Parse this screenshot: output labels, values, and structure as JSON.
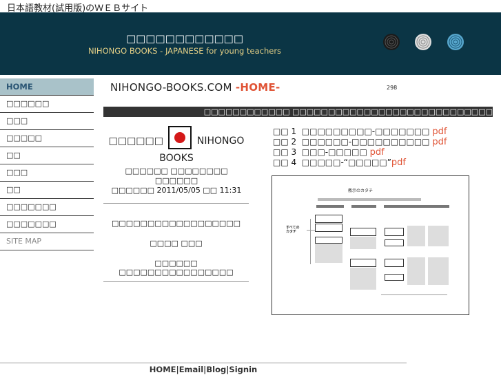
{
  "top_bar": {
    "text": "日本語教材(試用版)のＷＥＢサイト"
  },
  "banner": {
    "title": "□□□□□□□□□□□□",
    "subtitle": "NIHONGO BOOKS - JAPANESE for young teachers",
    "ring_color_dark": "#1b1b1b",
    "ring_color_light": "#cfcfcf",
    "ring_color_blue": "#57a6cc"
  },
  "sidebar": {
    "items": [
      {
        "label": "HOME"
      },
      {
        "label": "□□□□□□"
      },
      {
        "label": "□□□"
      },
      {
        "label": "□□□□□"
      },
      {
        "label": "□□"
      },
      {
        "label": "□□□"
      },
      {
        "label": "□□"
      },
      {
        "label": "□□□□□□□"
      },
      {
        "label": "□□□□□□□"
      },
      {
        "label": "SITE MAP"
      }
    ]
  },
  "main": {
    "heading_site": "NIHONGO-BOOKS.COM ",
    "heading_page": "-HOME-",
    "counter": "298",
    "dark_bar_text": "□□□□□□□□□□□□  □□□□□□□□□□□□□□□□□□□□□□□□□□□□",
    "logo_prefix": "□□□□□□",
    "logo_suffix": "NIHONGO",
    "logo_books": "BOOKS",
    "meta_line1": "□□□□□□ □□□□□□□□ □□□□□□",
    "meta_date_prefix": "□□□□□□",
    "meta_date": "2011/05/05",
    "meta_time_prefix": "□□",
    "meta_time": "11:31",
    "para1": "□□□□□□□□□□□□□□□□□□",
    "para2": "□□□□ □□□",
    "para3": "□□□□□□ □□□□□□□□□□□□□□□□",
    "pdf_links": [
      {
        "num": "□□ 1",
        "title": "□□□□□□□□□-□□□□□□□",
        "suffix": "pdf"
      },
      {
        "num": "□□ 2",
        "title": "□□□□□□-□□□□□□□□□□",
        "suffix": "pdf"
      },
      {
        "num": "□□ 3",
        "title": "□□□-□□□□□",
        "suffix": "pdf"
      },
      {
        "num": "□□ 4",
        "title": "□□□□□-“□□□□□”",
        "suffix": "pdf"
      }
    ],
    "preview": {
      "title": "教示のカタチ",
      "left_label": "すべての\nカタチ"
    }
  },
  "footer": {
    "links": "HOME|Email|Blog|Signin"
  },
  "colors": {
    "banner": "#0b3545",
    "accent": "#e05335",
    "nav_active": "#a9c2c9",
    "subtitle": "#e3cf86"
  }
}
